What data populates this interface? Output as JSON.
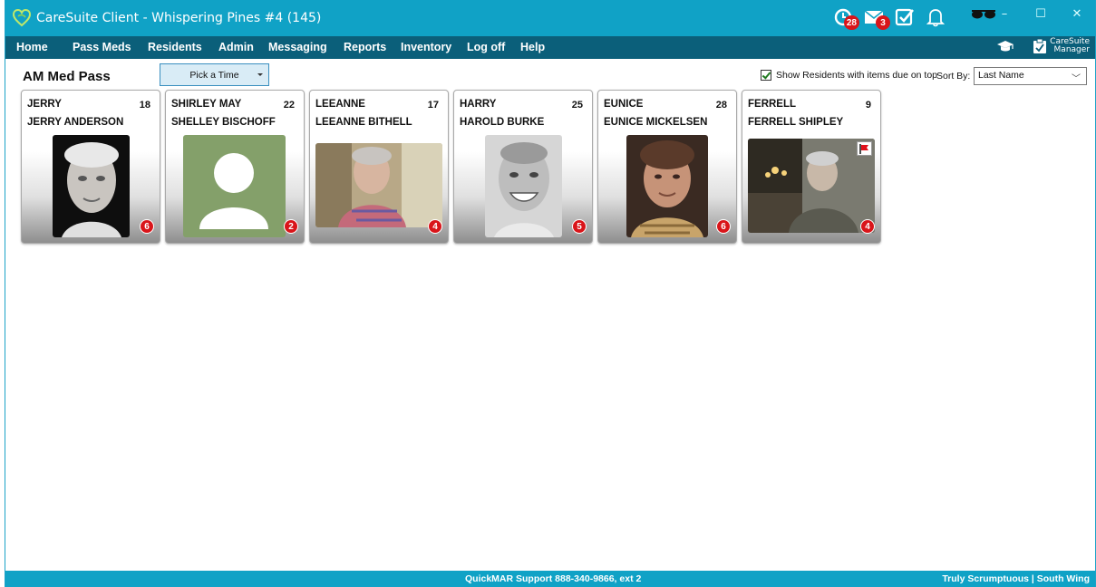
{
  "window": {
    "title": "CareSuite Client - Whispering Pines #4 (145)",
    "controls": {
      "minimize": "–",
      "maximize": "☐",
      "close": "✕"
    }
  },
  "title_icons": {
    "alerts_badge": "28",
    "messages_badge": "3"
  },
  "menu": {
    "items": [
      "Home",
      "Pass Meds",
      "Residents",
      "Admin",
      "Messaging",
      "Reports",
      "Inventory",
      "Log off",
      "Help"
    ],
    "manager_logo_line1": "CareSuite",
    "manager_logo_line2": "Manager"
  },
  "toolbar": {
    "page_title": "AM Med Pass",
    "time_picker_label": "Pick a Time",
    "show_residents_label": "Show Residents with items due on top",
    "show_residents_checked": true,
    "sort_by_label": "Sort By:",
    "sort_by_value": "Last Name"
  },
  "residents": [
    {
      "nickname": "JERRY",
      "number": "18",
      "full_name": "JERRY ANDERSON",
      "badge": "6",
      "flag": false,
      "photo": "portrait-elderly-man"
    },
    {
      "nickname": "SHIRLEY MAY",
      "number": "22",
      "full_name": "SHELLEY BISCHOFF",
      "badge": "2",
      "flag": false,
      "photo": "placeholder-person"
    },
    {
      "nickname": "LEEANNE",
      "number": "17",
      "full_name": "LEEANNE BITHELL",
      "badge": "4",
      "flag": false,
      "photo": "portrait-elderly-woman"
    },
    {
      "nickname": "HARRY",
      "number": "25",
      "full_name": "HAROLD BURKE",
      "badge": "5",
      "flag": false,
      "photo": "portrait-elderly-man-smiling"
    },
    {
      "nickname": "EUNICE",
      "number": "28",
      "full_name": "EUNICE MICKELSEN",
      "badge": "6",
      "flag": false,
      "photo": "portrait-elderly-woman-2"
    },
    {
      "nickname": "FERRELL",
      "number": "9",
      "full_name": "FERRELL SHIPLEY",
      "badge": "4",
      "flag": true,
      "photo": "portrait-elderly-man-room"
    }
  ],
  "status": {
    "support": "QuickMAR Support 888-340-9866, ext 2",
    "location": "Truly Scrumptuous | South Wing"
  },
  "colors": {
    "titlebar": "#10a2c6",
    "menubar": "#0b5f7a",
    "badge": "#d9151a",
    "placeholder_bg": "#84a06a"
  }
}
